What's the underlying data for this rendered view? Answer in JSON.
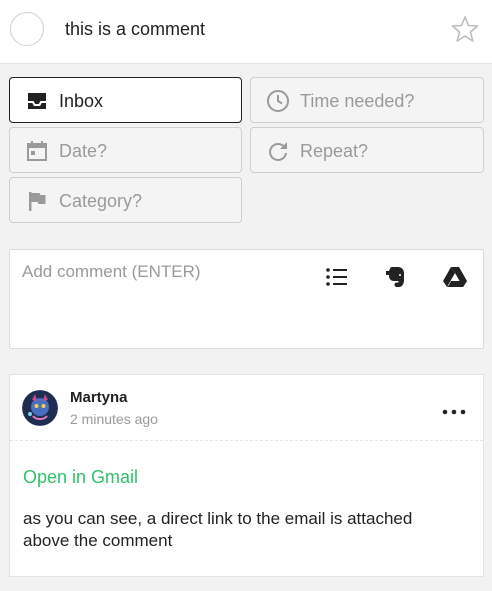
{
  "task": {
    "title": "this is a comment"
  },
  "fields": {
    "inbox": "Inbox",
    "time_needed": "Time needed?",
    "date": "Date?",
    "repeat": "Repeat?",
    "category": "Category?"
  },
  "comment_box": {
    "placeholder": "Add comment (ENTER)",
    "value": "",
    "tools": [
      "list-icon",
      "evernote-icon",
      "google-drive-icon"
    ]
  },
  "comment": {
    "author": "Martyna",
    "time": "2 minutes ago",
    "link_text": "Open in Gmail",
    "text": "as you can see, a direct link to the email is attached above the comment"
  },
  "colors": {
    "accent_green": "#2ec36a",
    "placeholder_gray": "#9a9a9a",
    "background": "#f2f2f2"
  }
}
